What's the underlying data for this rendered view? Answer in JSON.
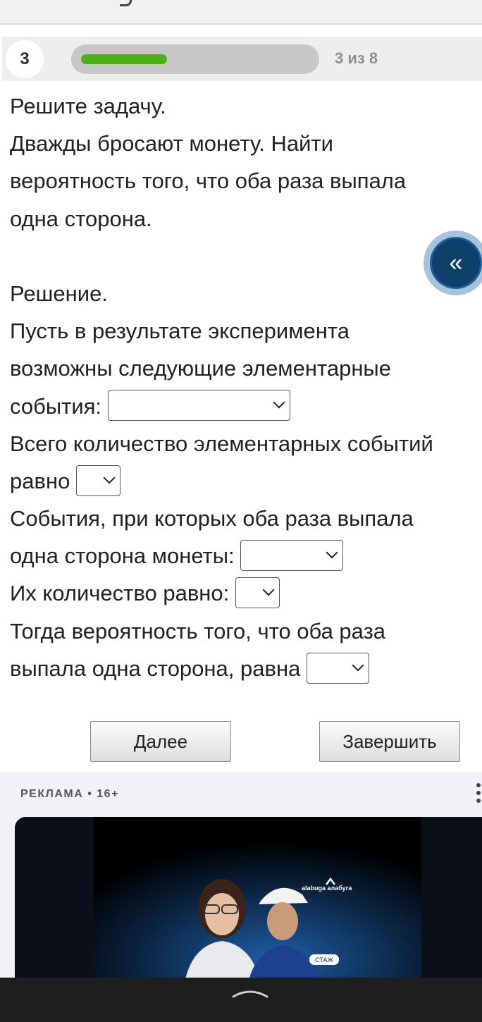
{
  "progress": {
    "question_number": "3",
    "counter": "3 из 8",
    "fraction": 0.375,
    "fill_color": "#4caf1a"
  },
  "task": {
    "lines": [
      "Решите задачу.",
      "Дважды бросают монету. Найти",
      "вероятность того, что оба раза выпала",
      "одна сторона.",
      "",
      "Решение.",
      "Пусть в результате эксперимента",
      "возможны следующие элементарные"
    ],
    "line_events": "события:",
    "line_total": "Всего количество элементарных событий",
    "line_equals": "равно",
    "line_same_side": "События, при которых оба раза выпала",
    "line_same_side_2": "одна сторона монеты:",
    "line_count": "Их количество равно:",
    "line_then": "Тогда вероятность того, что оба раза",
    "line_prob": "выпала одна сторона, равна"
  },
  "dropdowns": {
    "events": "",
    "total": "",
    "same_side_events": "",
    "count": "",
    "probability": ""
  },
  "fab": {
    "icon": "double-chevron-left-icon",
    "glyph": "«"
  },
  "buttons": {
    "next": "Далее",
    "finish": "Завершить"
  },
  "ad": {
    "label": "РЕКЛАМА • 16+",
    "logo_text": "alabuga алабуга",
    "badge": "СТАЖ"
  },
  "colors": {
    "accent_green": "#4caf1a",
    "fab_blue": "#0f3f6b"
  }
}
